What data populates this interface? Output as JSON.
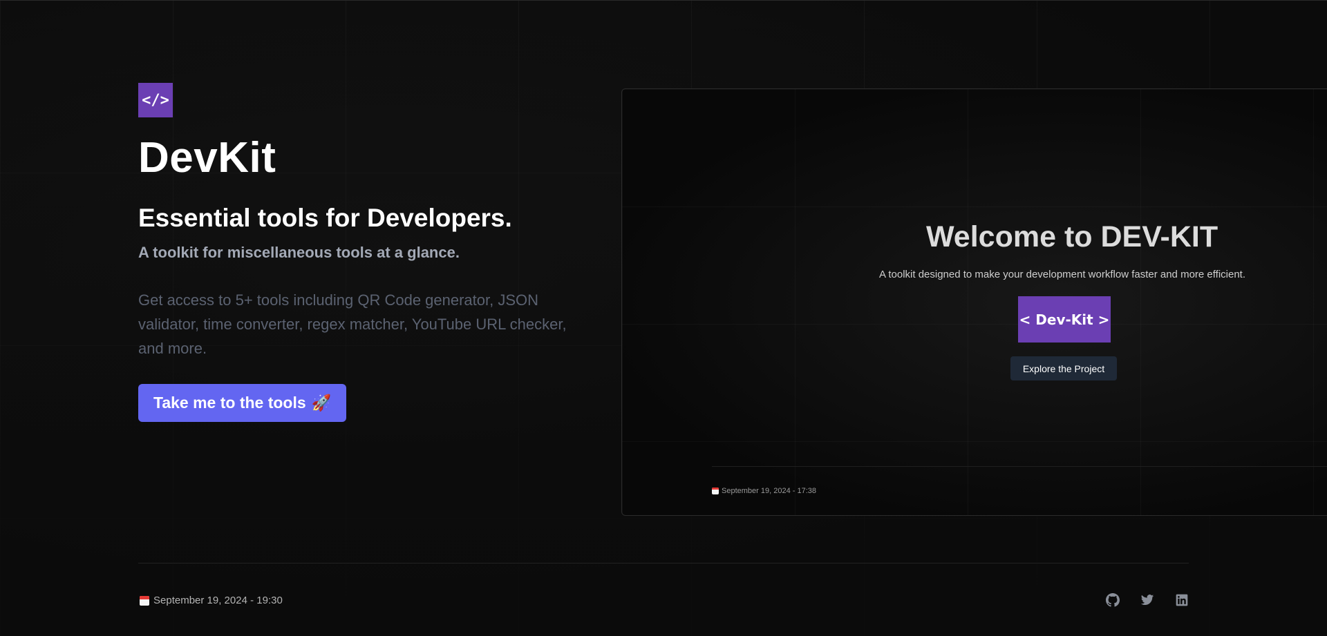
{
  "hero": {
    "logo_text": "</>",
    "brand": "DevKit",
    "tagline": "Essential tools for Developers.",
    "subtitle": "A toolkit for miscellaneous tools at a glance.",
    "description": "Get access to 5+ tools including QR Code generator, JSON validator, time converter, regex matcher, YouTube URL checker, and more.",
    "cta_label": "Take me to the tools",
    "cta_icon": "rocket-icon"
  },
  "preview": {
    "title": "Welcome to DEV-KIT",
    "description": "A toolkit designed to make your development workflow faster and more efficient.",
    "logo_text": "< Dev-Kit >",
    "button_label": "Explore the Project",
    "date": "September 19, 2024 - 17:38"
  },
  "footer": {
    "date": "September 19, 2024 - 19:30",
    "socials": [
      "github-icon",
      "twitter-icon",
      "linkedin-icon"
    ]
  },
  "colors": {
    "accent": "#6366f1",
    "logo_bg": "#6b3fb3",
    "background": "#0b0b0b"
  }
}
